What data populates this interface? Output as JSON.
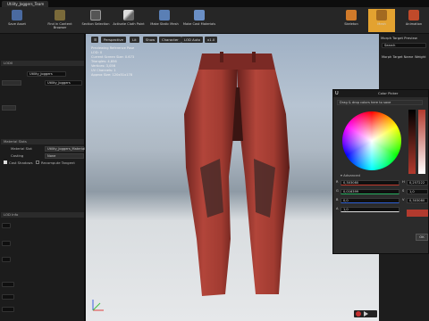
{
  "window": {
    "tab_title": "Utility_Joggers_Team"
  },
  "toolbar": {
    "buttons": [
      {
        "label": "Save Asset",
        "icon": "save-icon"
      },
      {
        "label": "Find in Content Browser",
        "icon": "browse-icon"
      },
      {
        "label": "Section Selection",
        "icon": "select-icon"
      },
      {
        "label": "Activate Cloth Paint",
        "icon": "brush-icon"
      },
      {
        "label": "Make Static Mesh",
        "icon": "mesh-icon"
      },
      {
        "label": "Make Cast Materials",
        "icon": "layers-icon"
      }
    ],
    "mode_tabs": [
      "Skeleton",
      "Mesh",
      "Animation"
    ]
  },
  "left_panel": {
    "labels": [
      "Material Slot",
      "Casting",
      "Cast Shadows",
      "Recompute Tangent"
    ],
    "fields": [
      "Utility_Joggers",
      "Utility_Joggers",
      "Utility_Joggers_Material",
      "None"
    ],
    "sections": [
      "LOD0",
      "Material Slots",
      "LOD Info"
    ]
  },
  "viewport": {
    "buttons": [
      "Perspective",
      "Lit",
      "Show",
      "Character",
      "LOD Auto",
      "x1.0"
    ],
    "stats": [
      "Previewing Reference Pose",
      "LOD: 0",
      "Current Screen Size: 0.673",
      "Triangles: 4,856",
      "Vertices: 3,056",
      "UV Channels: 1",
      "Approx Size: 120x51x178"
    ]
  },
  "right_panel": {
    "title": "Morph Target Preview",
    "search": "Search",
    "columns": [
      "Morph Target Name",
      "Weight"
    ]
  },
  "color_picker": {
    "title": "Color Picker",
    "dropdown": "Drag & drop colors here to save",
    "advanced_label": "Advanced",
    "channels": [
      {
        "label": "R",
        "value": "0,303080",
        "color": "#c0392b"
      },
      {
        "label": "G",
        "value": "0,016399",
        "color": "#27ae60"
      },
      {
        "label": "B",
        "value": "0,0",
        "color": "#2e5fd3"
      },
      {
        "label": "A",
        "value": "1,0",
        "color": "#dddddd"
      }
    ],
    "hsv": [
      {
        "label": "H",
        "value": "0,257222"
      },
      {
        "label": "S",
        "value": "1,0"
      },
      {
        "label": "V",
        "value": "0,303080"
      }
    ],
    "ok_label": "OK",
    "current_color": "#b23a2e"
  }
}
